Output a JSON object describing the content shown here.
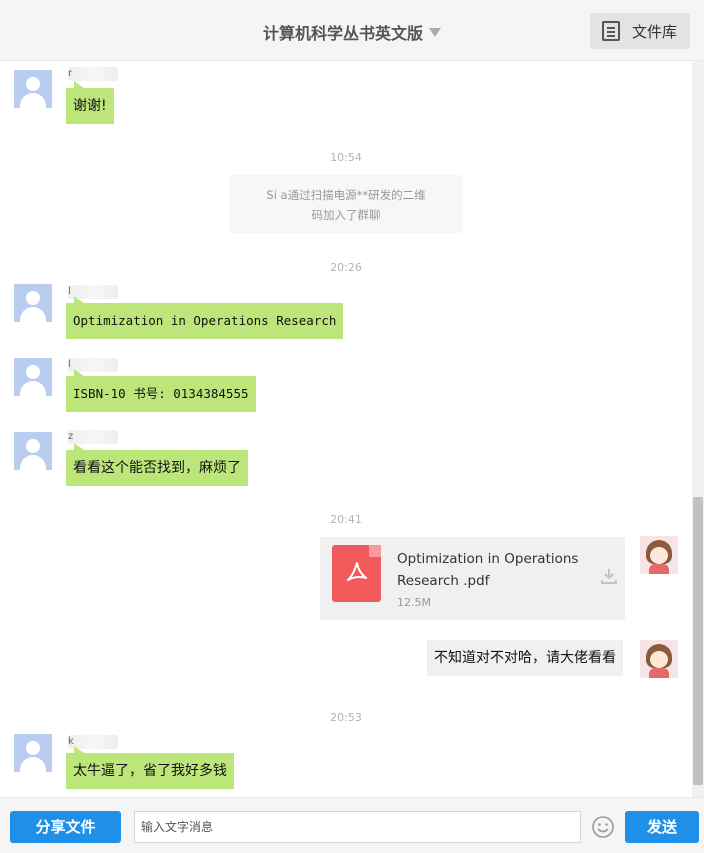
{
  "header": {
    "title": "计算机科学丛书英文版",
    "library_label": "文件库"
  },
  "messages": [
    {
      "nick": "r",
      "text": "谢谢!"
    },
    {
      "nick": "l",
      "text": "Optimization in Operations Research"
    },
    {
      "nick": "l",
      "text": "ISBN-10 书号: 0134384555"
    },
    {
      "nick": "z",
      "text": "看看这个能否找到，麻烦了"
    },
    {
      "text": "不知道对不对哈，请大佬看看"
    },
    {
      "nick": "k",
      "text": "太牛逼了，省了我好多钱"
    }
  ],
  "times": [
    "10:54",
    "20:26",
    "20:41",
    "20:53"
  ],
  "system_note": {
    "line1": "Si        a通过扫描电源**研发的二维",
    "line2": "码加入了群聊"
  },
  "file": {
    "name": "Optimization in Operations Research .pdf",
    "size": "12.5M"
  },
  "footer": {
    "share_label": "分享文件",
    "input_placeholder": "输入文字消息",
    "send_label": "发送"
  },
  "colors": {
    "bubble_green": "#bde67a",
    "button_blue": "#1e90e8",
    "pdf_red": "#f15b5b"
  }
}
